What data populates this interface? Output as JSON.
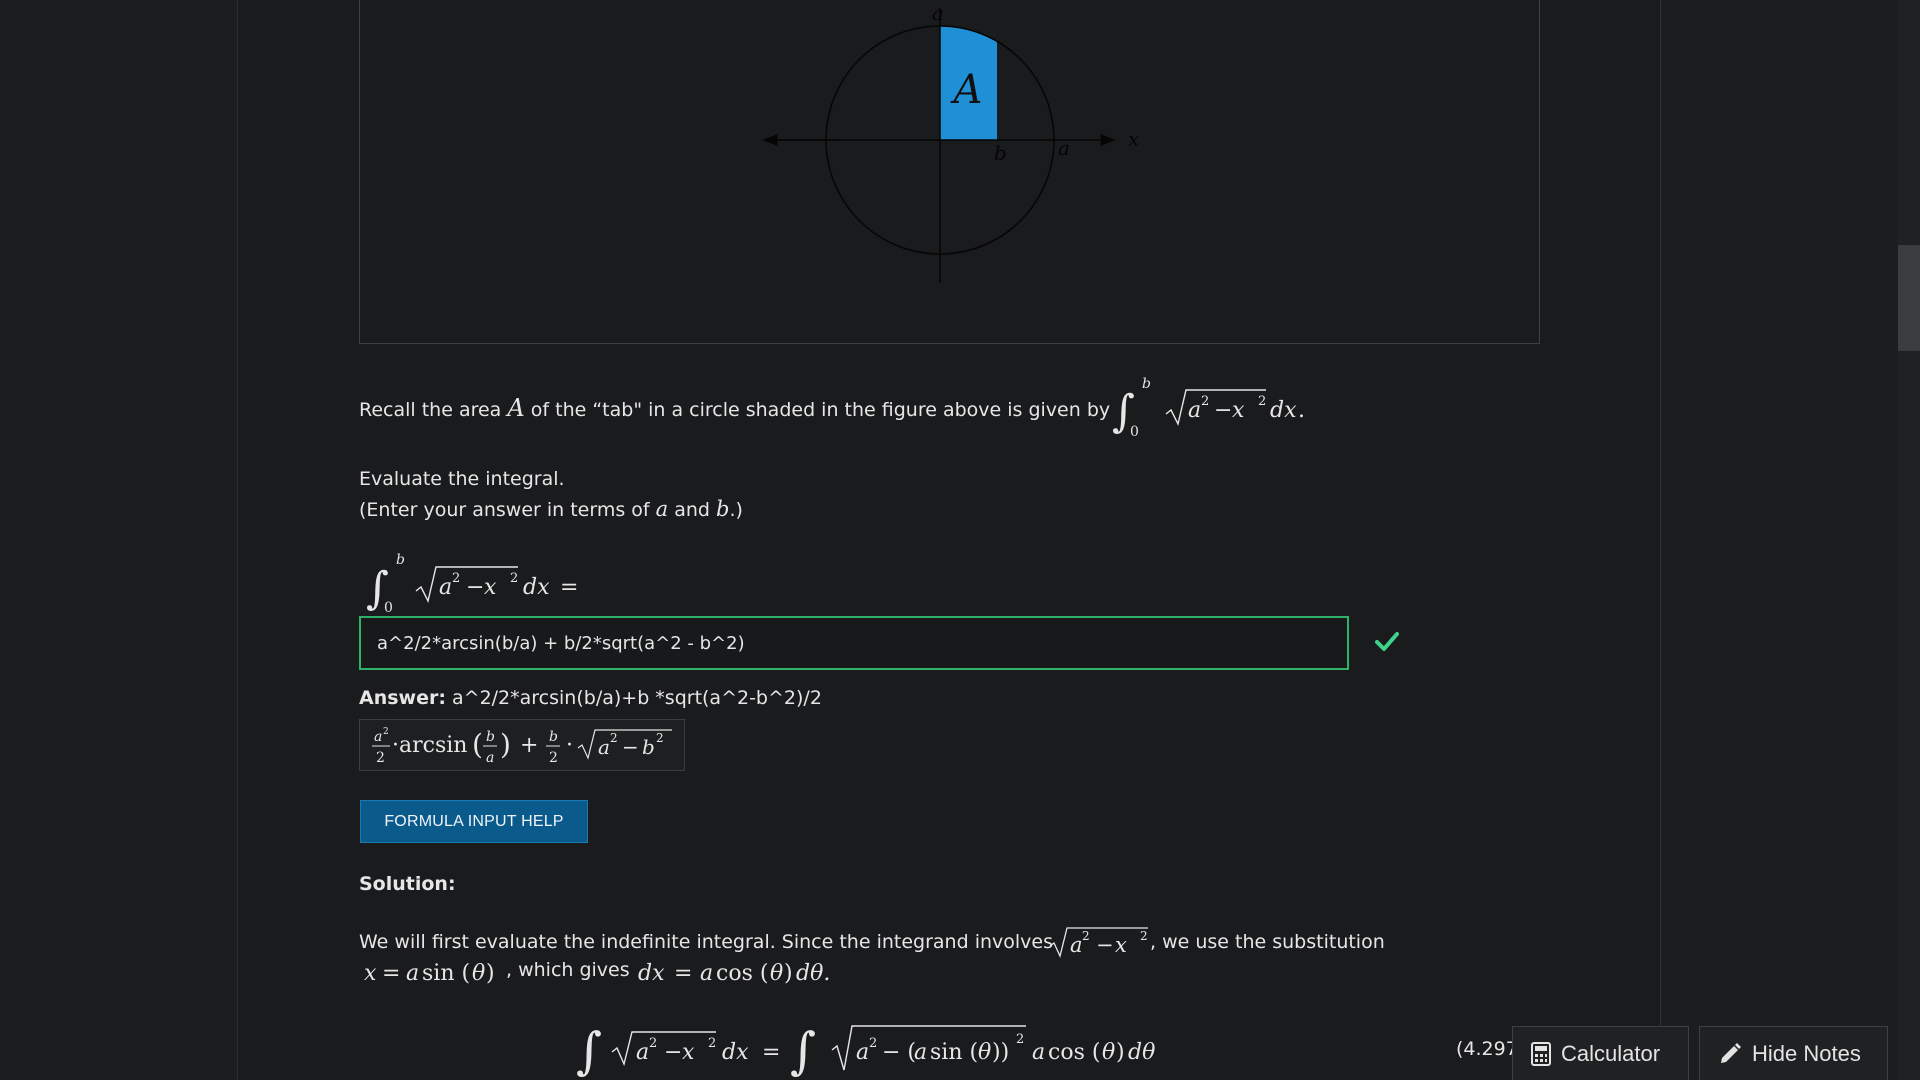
{
  "figure": {
    "region_label": "A",
    "axis_x_label": "x",
    "axis_y_label": "a",
    "mark_b": "b",
    "mark_a": "a",
    "colors": {
      "shaded": "#1f8fd6",
      "axes": "#050505"
    }
  },
  "question": {
    "recall_text": "Recall the area",
    "recall_var": "A",
    "recall_tail": "of the “tab\" in a circle shaded in the figure above is given by",
    "evaluate_line": "Evaluate the integral.",
    "enter_prefix": "(Enter your answer in terms of",
    "enter_a": "a",
    "enter_and": "and",
    "enter_b": "b",
    "enter_suffix": ".)"
  },
  "answer_input": {
    "value": "a^2/2*arcsin(b/a) + b/2*sqrt(a^2 - b^2)",
    "status": "correct"
  },
  "answer": {
    "label": "Answer:",
    "text": "a^2/2*arcsin(b/a)+b *sqrt(a^2-b^2)/2"
  },
  "help_button": {
    "label": "FORMULA INPUT HELP"
  },
  "solution": {
    "label": "Solution:",
    "line1_pre": "We will first evaluate the indefinite integral. Since the integrand involves",
    "line1_post": ", we use the substitution",
    "line2_mid": ", which gives"
  },
  "footer": {
    "coord_text": "(4.297",
    "calculator_label": "Calculator",
    "hide_notes_label": "Hide Notes"
  }
}
